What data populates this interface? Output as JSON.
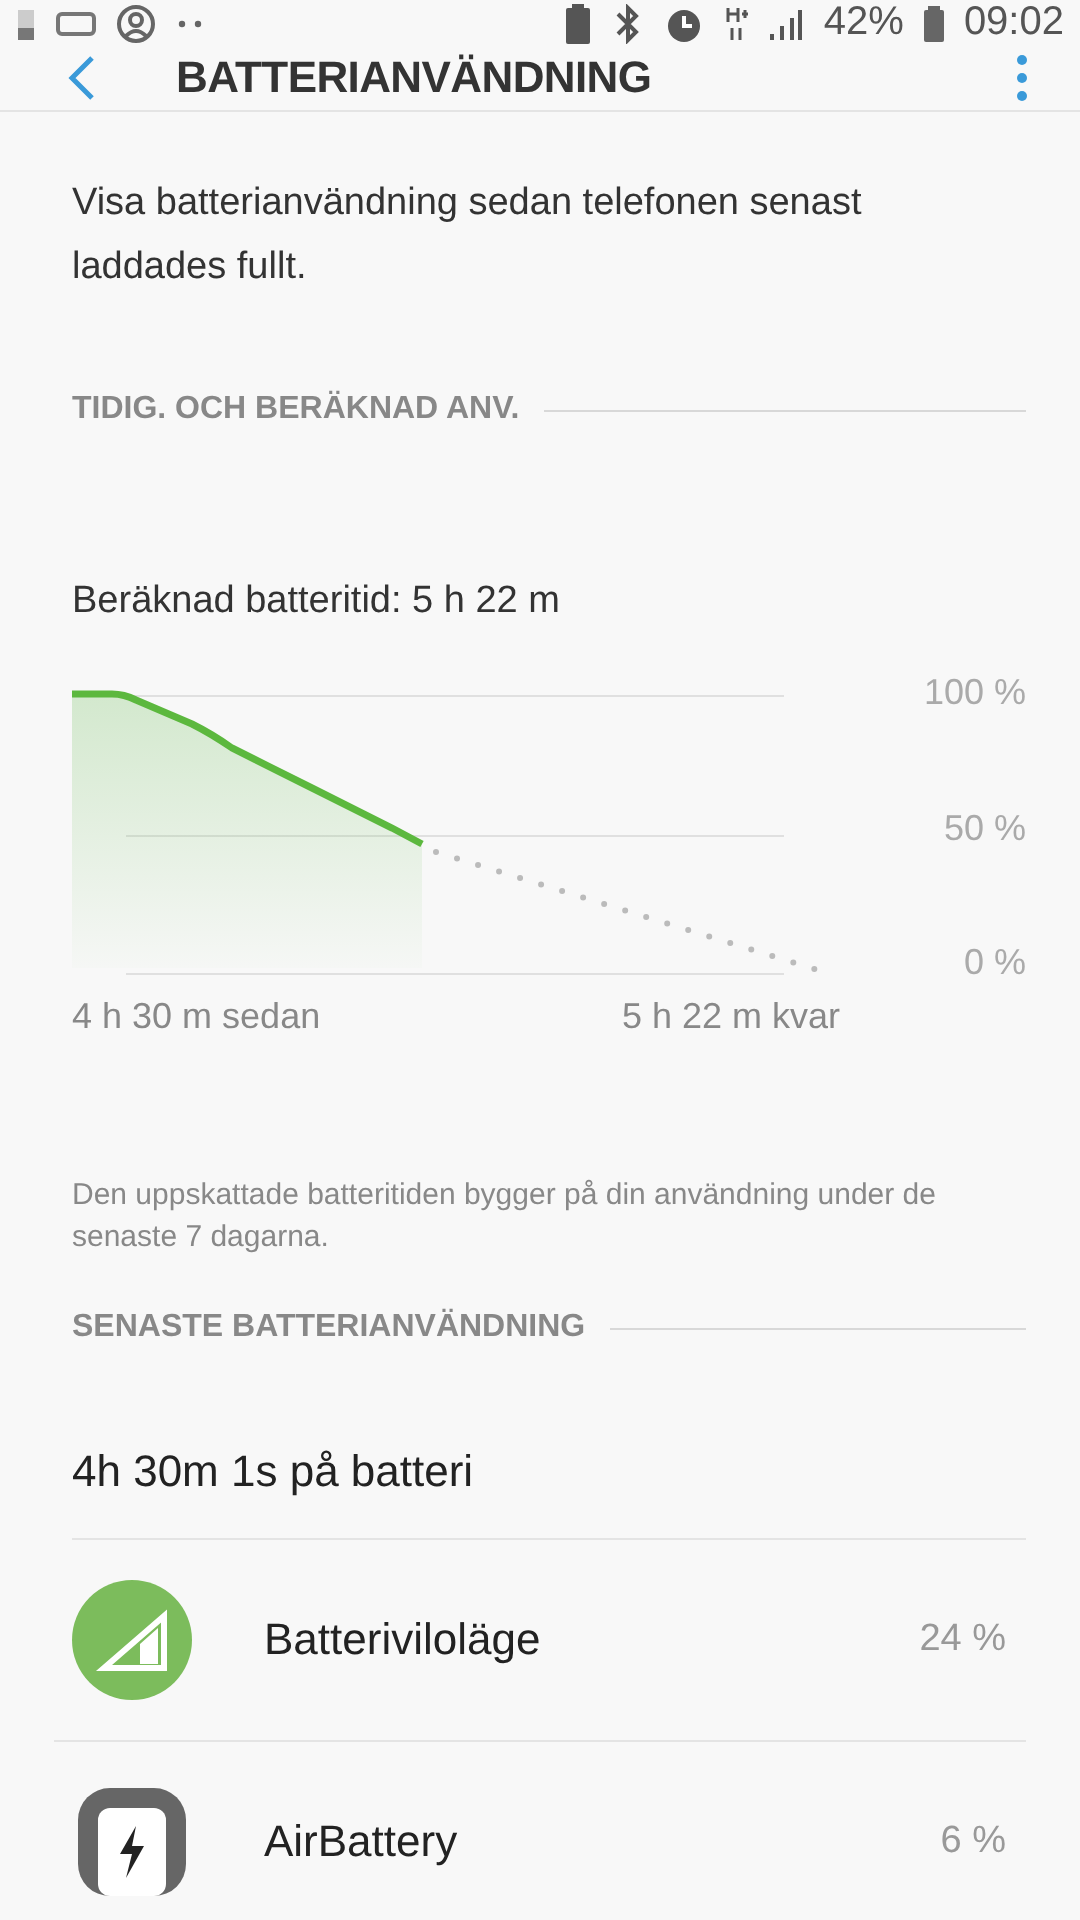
{
  "status_bar": {
    "battery_percent": "42%",
    "time": "09:02"
  },
  "app_bar": {
    "title": "BATTERIANVÄNDNING"
  },
  "description": "Visa batterianvändning sedan telefonen senast laddades fullt.",
  "usage_section": {
    "header": "TIDIG. OCH BERÄKNAD ANV.",
    "estimate": "Beräknad batteritid: 5 h 22 m",
    "y_labels": [
      "100 %",
      "50 %",
      "0 %"
    ],
    "x_start": "4 h 30 m sedan",
    "x_end": "5 h 22 m kvar",
    "note": "Den uppskattade batteritiden bygger på din användning under de senaste 7 dagarna."
  },
  "recent_section": {
    "header": "SENASTE BATTERIANVÄNDNING",
    "summary": "4h 30m 1s på batteri",
    "apps": [
      {
        "kind": "power-saving",
        "name": "Batteriviloläge",
        "percent": "24 %"
      },
      {
        "kind": "app",
        "name": "AirBattery",
        "percent": "6 %"
      }
    ]
  }
}
